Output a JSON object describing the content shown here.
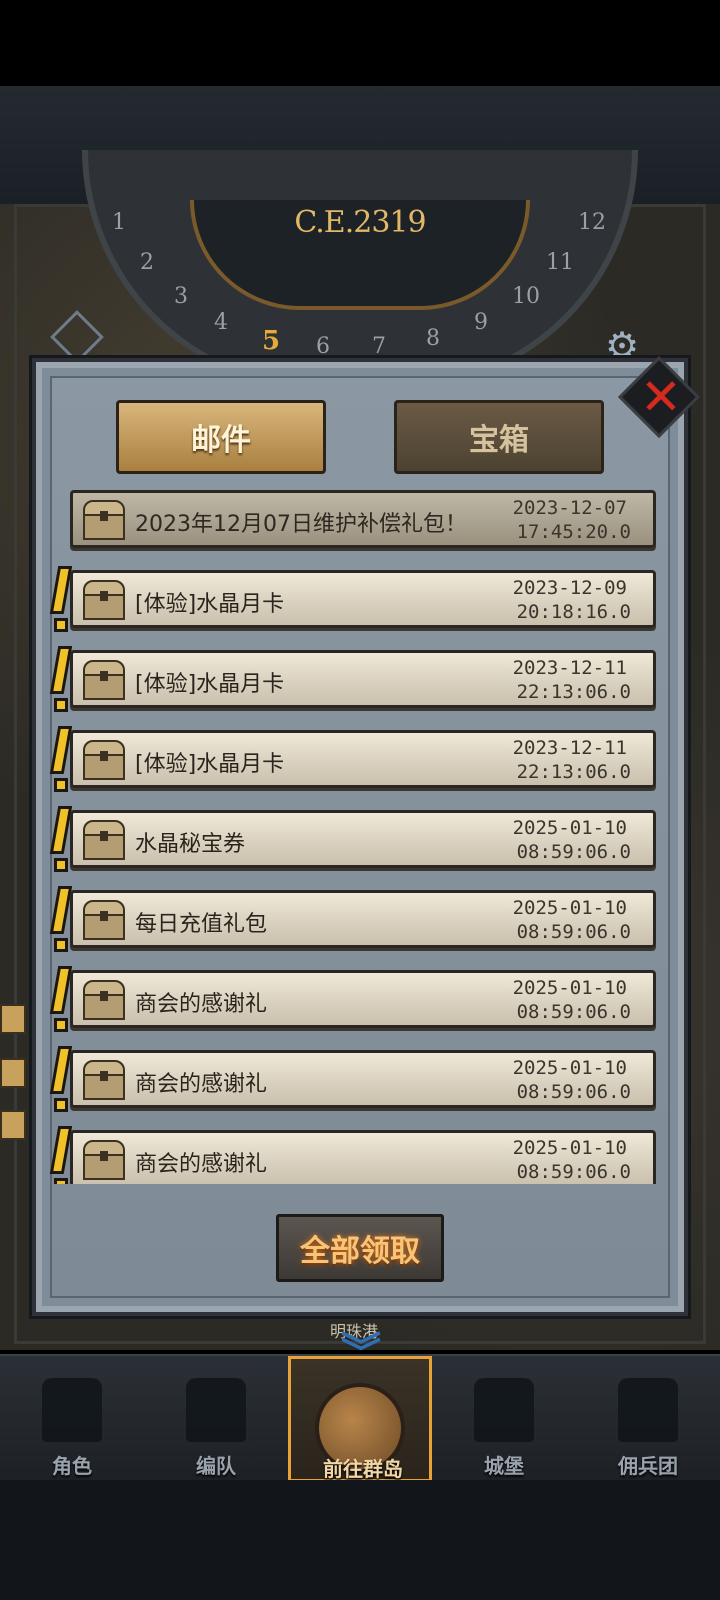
{
  "header": {
    "year": "C.E.2319",
    "wheel_numbers": [
      "1",
      "2",
      "3",
      "4",
      "5",
      "6",
      "7",
      "8",
      "9",
      "10",
      "11",
      "12"
    ],
    "active_number": "5"
  },
  "dialog": {
    "tabs": [
      {
        "label": "邮件",
        "active": true
      },
      {
        "label": "宝箱",
        "active": false
      }
    ],
    "mails": [
      {
        "title": "2023年12月07日维护补偿礼包！",
        "date": "2023-12-07",
        "time": "17:45:20.0",
        "unread": false
      },
      {
        "title": "[体验]水晶月卡",
        "date": "2023-12-09",
        "time": "20:18:16.0",
        "unread": true
      },
      {
        "title": "[体验]水晶月卡",
        "date": "2023-12-11",
        "time": "22:13:06.0",
        "unread": true
      },
      {
        "title": "[体验]水晶月卡",
        "date": "2023-12-11",
        "time": "22:13:06.0",
        "unread": true
      },
      {
        "title": "水晶秘宝券",
        "date": "2025-01-10",
        "time": "08:59:06.0",
        "unread": true
      },
      {
        "title": "每日充值礼包",
        "date": "2025-01-10",
        "time": "08:59:06.0",
        "unread": true
      },
      {
        "title": "商会的感谢礼",
        "date": "2025-01-10",
        "time": "08:59:06.0",
        "unread": true
      },
      {
        "title": "商会的感谢礼",
        "date": "2025-01-10",
        "time": "08:59:06.0",
        "unread": true
      },
      {
        "title": "商会的感谢礼",
        "date": "2025-01-10",
        "time": "08:59:06.0",
        "unread": true
      }
    ],
    "claim_all_label": "全部领取",
    "close_icon": "close-icon"
  },
  "under_label": "明珠港",
  "nav": {
    "items": [
      {
        "label": "角色",
        "icon": "knight-icon"
      },
      {
        "label": "编队",
        "icon": "helmet-icon"
      },
      {
        "label": "前往群岛",
        "icon": "globe-icon",
        "active": true
      },
      {
        "label": "城堡",
        "icon": "castle-icon"
      },
      {
        "label": "佣兵团",
        "icon": "banner-icon"
      }
    ]
  },
  "colors": {
    "accent": "#e8a23a",
    "alert": "#f0c227",
    "close": "#d42a1f"
  }
}
